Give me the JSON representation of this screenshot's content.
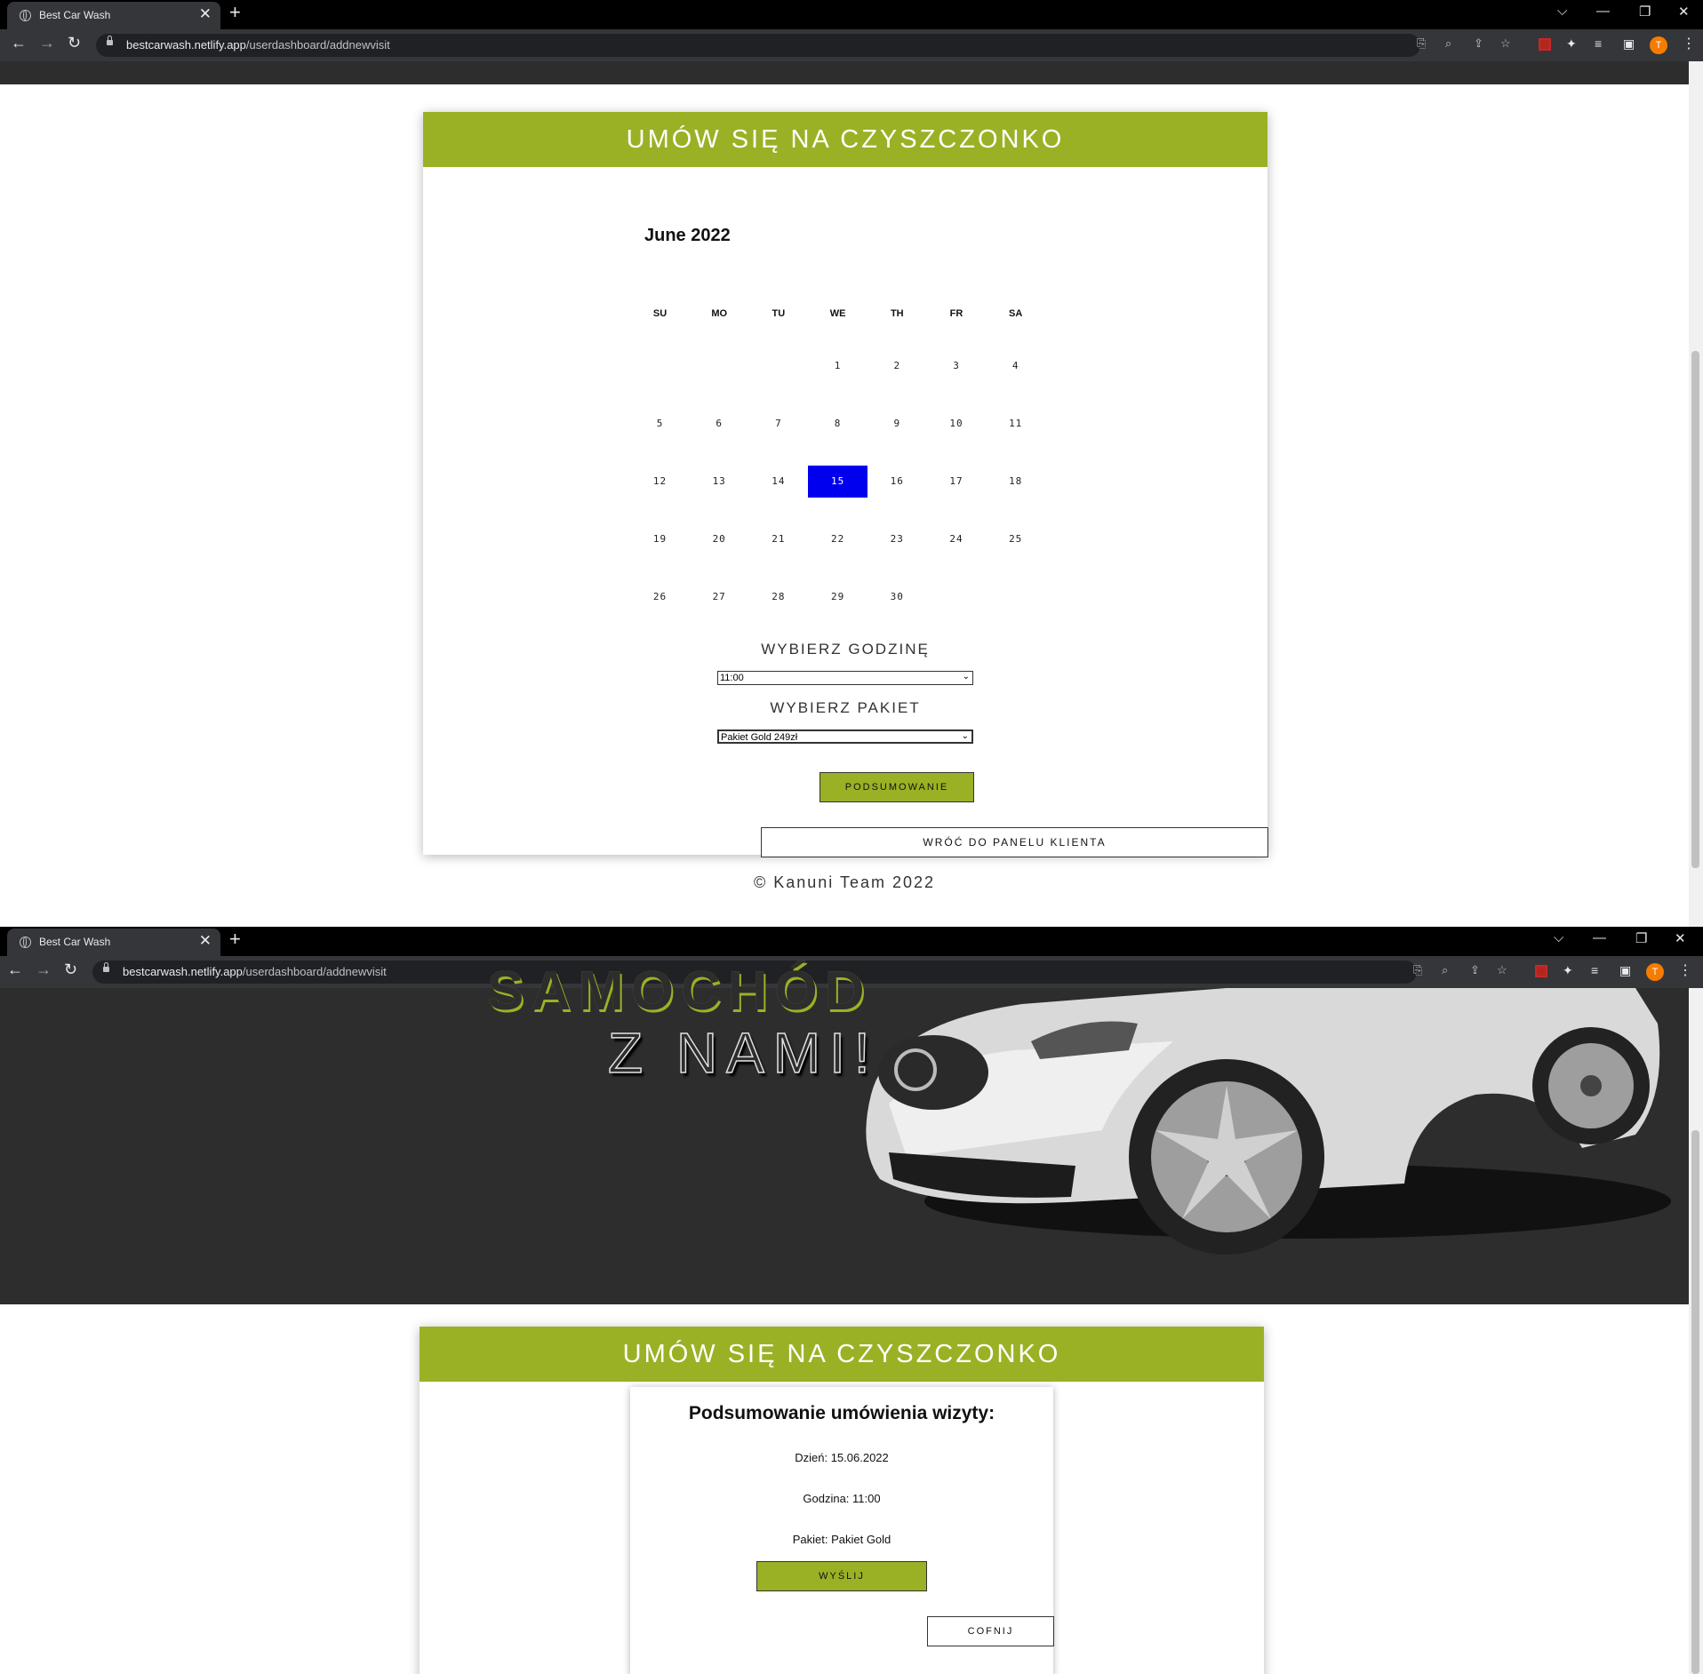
{
  "browser": {
    "tab_title": "Best Car Wash",
    "url_domain": "bestcarwash.netlify.app",
    "url_path": "/userdashboard/addnewvisit",
    "new_tab": "+",
    "close_tab": "✕",
    "profile_initial": "T"
  },
  "booking": {
    "header": "UMÓW SIĘ NA CZYSZCZONKO",
    "calendar": {
      "month": "June 2022",
      "weekdays": [
        "SU",
        "MO",
        "TU",
        "WE",
        "TH",
        "FR",
        "SA"
      ],
      "days": [
        "1",
        "2",
        "3",
        "4",
        "5",
        "6",
        "7",
        "8",
        "9",
        "10",
        "11",
        "12",
        "13",
        "14",
        "15",
        "16",
        "17",
        "18",
        "19",
        "20",
        "21",
        "22",
        "23",
        "24",
        "25",
        "26",
        "27",
        "28",
        "29",
        "30"
      ],
      "selected_day": "15"
    },
    "hour_label": "WYBIERZ GODZINĘ",
    "hour_value": "11:00",
    "package_label": "WYBIERZ PAKIET",
    "package_value": "Pakiet Gold 249zł",
    "summary_button": "PODSUMOWANIE",
    "back_button": "WRÓĆ DO PANELU KLIENTA",
    "footer": "© Kanuni Team 2022"
  },
  "hero": {
    "line1": "SAMOCHÓD",
    "line2": "Z NAMI!"
  },
  "summary": {
    "header": "UMÓW SIĘ NA CZYSZCZONKO",
    "title": "Podsumowanie umówienia wizyty:",
    "day": "Dzień: 15.06.2022",
    "hour": "Godzina: 11:00",
    "package": "Pakiet: Pakiet Gold",
    "send_button": "WYŚLIJ",
    "back_button": "COFNIJ"
  },
  "colors": {
    "accent": "#9ab125",
    "selected_day": "#0000ee",
    "dark_bg": "#2d2d2d"
  }
}
